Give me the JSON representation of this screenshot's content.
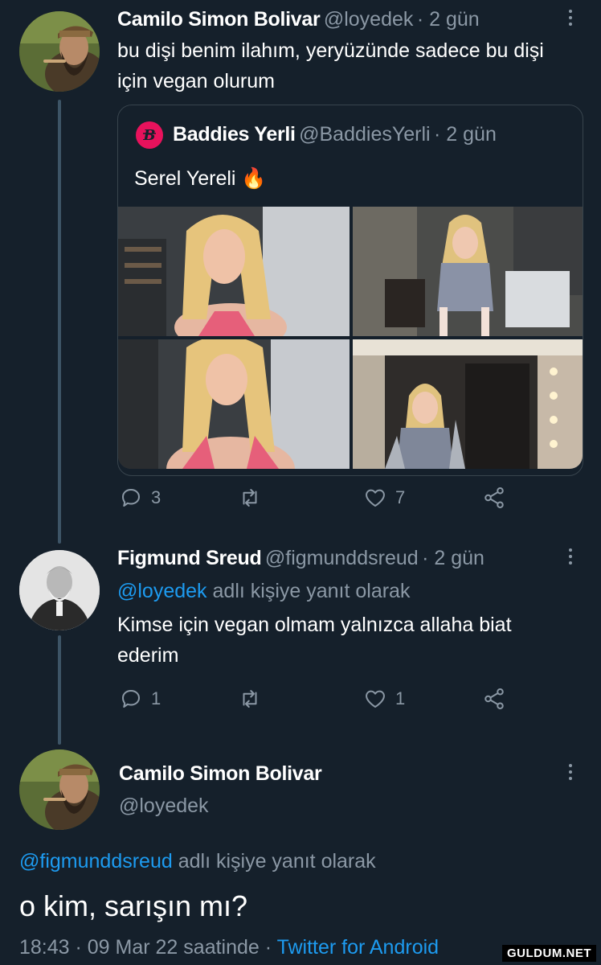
{
  "tweet1": {
    "name": "Camilo Simon Bolivar",
    "handle": "@loyedek",
    "time": "· 2 gün",
    "text": "bu dişi benim ilahım, yeryüzünde sadece bu dişi için vegan olurum",
    "quote": {
      "name": "Baddies Yerli",
      "handle": "@BaddiesYerli",
      "time": "· 2 gün",
      "text": "Serel Yereli 🔥"
    },
    "replies": "3",
    "retweets": "",
    "likes": "7"
  },
  "tweet2": {
    "name": "Figmund Sreud",
    "handle": "@figmunddsreud",
    "time": "· 2 gün",
    "reply_to_handle": "@loyedek",
    "reply_to_suffix": " adlı kişiye yanıt olarak",
    "text": "Kimse için vegan olmam yalnızca allaha biat ederim",
    "replies": "1",
    "retweets": "",
    "likes": "1"
  },
  "tweet3": {
    "name": "Camilo Simon Bolivar",
    "handle": "@loyedek",
    "reply_to_handle": "@figmunddsreud",
    "reply_to_suffix": " adlı kişiye yanıt olarak",
    "text": "o kim, sarışın mı?",
    "timestamp": "18:43 · 09 Mar 22 saatinde · ",
    "source": "Twitter for Android"
  },
  "watermark": "GULDUM.NET",
  "colors": {
    "background": "#15202b",
    "link": "#1d9bf0",
    "muted": "#8b98a5",
    "border": "#38444d"
  }
}
